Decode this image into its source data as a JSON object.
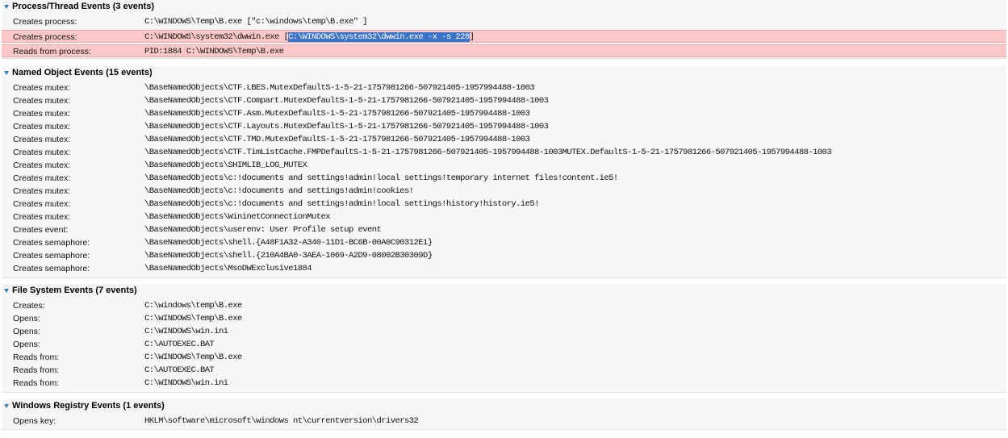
{
  "sections": [
    {
      "title": "Process/Thread Events (3 events)",
      "rows": [
        {
          "label": "Creates process:",
          "value": "C:\\WINDOWS\\Temp\\B.exe [\"c:\\windows\\temp\\B.exe\" ]"
        },
        {
          "label": "Creates process:",
          "value_pre": "C:\\WINDOWS\\system32\\dwwin.exe [",
          "value_sel": "C:\\WINDOWS\\system32\\dwwin.exe -x -s 228",
          "value_post": "]",
          "highlight": true
        },
        {
          "label": "Reads from process:",
          "value": "PID:1884 C:\\WINDOWS\\Temp\\B.exe",
          "highlight": true
        }
      ]
    },
    {
      "title": "Named Object Events (15 events)",
      "rows": [
        {
          "label": "Creates mutex:",
          "value": "\\BaseNamedObjects\\CTF.LBES.MutexDefaultS-1-5-21-1757981266-507921405-1957994488-1003"
        },
        {
          "label": "Creates mutex:",
          "value": "\\BaseNamedObjects\\CTF.Compart.MutexDefaultS-1-5-21-1757981266-507921405-1957994488-1003"
        },
        {
          "label": "Creates mutex:",
          "value": "\\BaseNamedObjects\\CTF.Asm.MutexDefaultS-1-5-21-1757981266-507921405-1957994488-1003"
        },
        {
          "label": "Creates mutex:",
          "value": "\\BaseNamedObjects\\CTF.Layouts.MutexDefaultS-1-5-21-1757981266-507921405-1957994488-1003"
        },
        {
          "label": "Creates mutex:",
          "value": "\\BaseNamedObjects\\CTF.TMD.MutexDefaultS-1-5-21-1757981266-507921405-1957994488-1003"
        },
        {
          "label": "Creates mutex:",
          "value": "\\BaseNamedObjects\\CTF.TimListCache.FMPDefaultS-1-5-21-1757981266-507921405-1957994488-1003MUTEX.DefaultS-1-5-21-1757981266-507921405-1957994488-1003"
        },
        {
          "label": "Creates mutex:",
          "value": "\\BaseNamedObjects\\SHIMLIB_LOG_MUTEX"
        },
        {
          "label": "Creates mutex:",
          "value": "\\BaseNamedObjects\\c:!documents and settings!admin!local settings!temporary internet files!content.ie5!"
        },
        {
          "label": "Creates mutex:",
          "value": "\\BaseNamedObjects\\c:!documents and settings!admin!cookies!"
        },
        {
          "label": "Creates mutex:",
          "value": "\\BaseNamedObjects\\c:!documents and settings!admin!local settings!history!history.ie5!"
        },
        {
          "label": "Creates mutex:",
          "value": "\\BaseNamedObjects\\WininetConnectionMutex"
        },
        {
          "label": "Creates event:",
          "value": "\\BaseNamedObjects\\userenv:  User Profile setup event"
        },
        {
          "label": "Creates semaphore:",
          "value": "\\BaseNamedObjects\\shell.{A48F1A32-A340-11D1-BC6B-00A0C90312E1}"
        },
        {
          "label": "Creates semaphore:",
          "value": "\\BaseNamedObjects\\shell.{210A4BA0-3AEA-1069-A2D9-08002B30309D}"
        },
        {
          "label": "Creates semaphore:",
          "value": "\\BaseNamedObjects\\MsoDWExclusive1884"
        }
      ]
    },
    {
      "title": "File System Events (7 events)",
      "rows": [
        {
          "label": "Creates:",
          "value": "C:\\windows\\temp\\B.exe"
        },
        {
          "label": "Opens:",
          "value": "C:\\WINDOWS\\Temp\\B.exe"
        },
        {
          "label": "Opens:",
          "value": "C:\\WINDOWS\\win.ini"
        },
        {
          "label": "Opens:",
          "value": "C:\\AUTOEXEC.BAT"
        },
        {
          "label": "Reads from:",
          "value": "C:\\WINDOWS\\Temp\\B.exe"
        },
        {
          "label": "Reads from:",
          "value": "C:\\AUTOEXEC.BAT"
        },
        {
          "label": "Reads from:",
          "value": "C:\\WINDOWS\\win.ini"
        }
      ]
    },
    {
      "title": "Windows Registry Events (1 events)",
      "rows": [
        {
          "label": "Opens key:",
          "value": "HKLM\\software\\microsoft\\windows nt\\currentversion\\drivers32"
        }
      ]
    }
  ],
  "icons": {
    "section_toggle": "triangle-down-icon"
  },
  "colors": {
    "highlight_row": "#ffc8c8",
    "selection": "#3b73c6",
    "toggle": "#3b7fb0"
  }
}
